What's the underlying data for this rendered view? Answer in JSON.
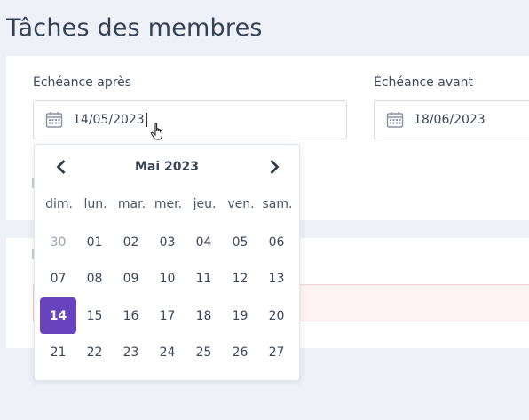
{
  "page": {
    "title": "Tâches des membres"
  },
  "filters": {
    "after": {
      "label": "Echéance après",
      "value": "14/05/2023"
    },
    "before": {
      "label": "Échéance avant",
      "value": "18/06/2023"
    }
  },
  "datepicker": {
    "month_title": "Mai 2023",
    "weekdays": [
      "dim.",
      "lun.",
      "mar.",
      "mer.",
      "jeu.",
      "ven.",
      "sam."
    ],
    "weeks": [
      [
        "30",
        "01",
        "02",
        "03",
        "04",
        "05",
        "06"
      ],
      [
        "07",
        "08",
        "09",
        "10",
        "11",
        "12",
        "13"
      ],
      [
        "14",
        "15",
        "16",
        "17",
        "18",
        "19",
        "20"
      ],
      [
        "21",
        "22",
        "23",
        "24",
        "25",
        "26",
        "27"
      ]
    ],
    "muted_days": [
      "30"
    ],
    "selected_day": "14"
  },
  "icons": {
    "prev": "chevron-left-icon",
    "next": "chevron-right-icon",
    "calendar": "calendar-icon",
    "cursor": "hand-pointer-icon"
  },
  "colors": {
    "accent": "#6744bd",
    "background": "#eef1f8",
    "alert": "#fdf3f4"
  }
}
